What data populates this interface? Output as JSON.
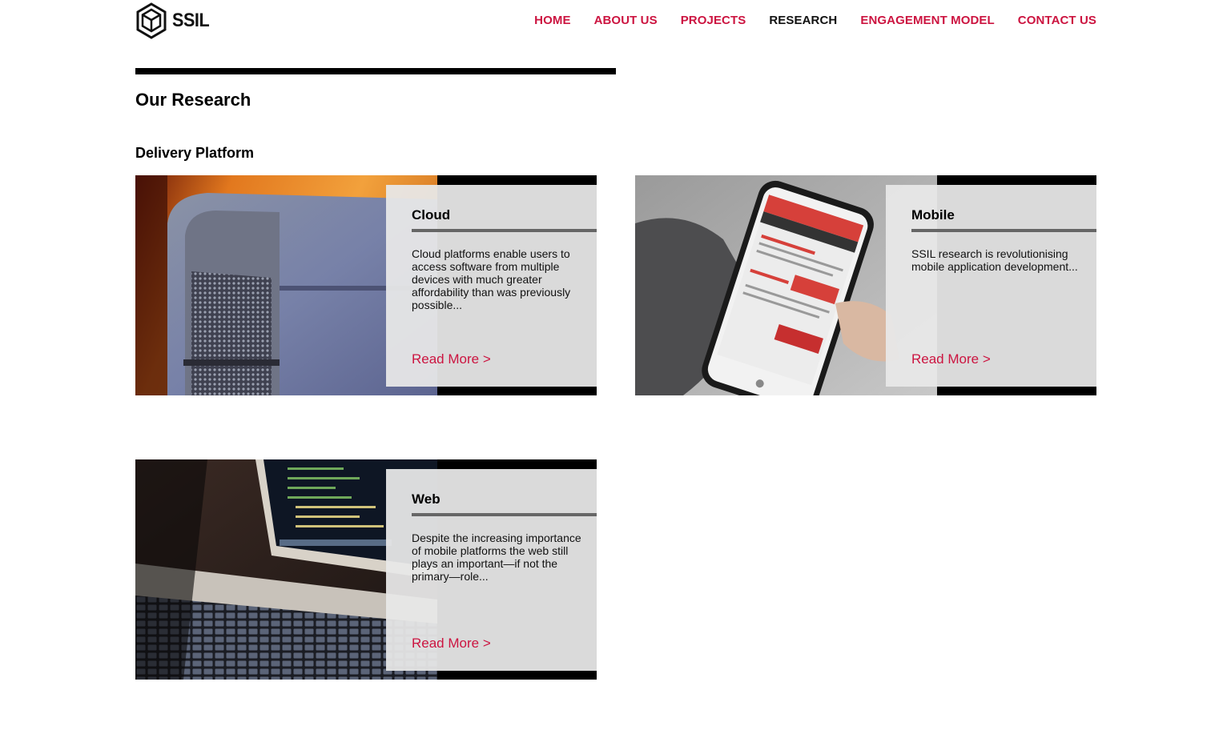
{
  "brand": {
    "name": "SSIL",
    "logo_icon": "hexagon-cube-logo"
  },
  "nav": {
    "items": [
      {
        "label": "HOME",
        "active": false
      },
      {
        "label": "ABOUT US",
        "active": false
      },
      {
        "label": "PROJECTS",
        "active": false
      },
      {
        "label": "RESEARCH",
        "active": true
      },
      {
        "label": "ENGAGEMENT MODEL",
        "active": false
      },
      {
        "label": "CONTACT US",
        "active": false
      }
    ]
  },
  "page": {
    "title": "Our Research",
    "section_title": "Delivery Platform"
  },
  "cards": [
    {
      "title": "Cloud",
      "text": "Cloud platforms enable users to access software from multiple devices with much greater affordability than was previously possible...",
      "link": "Read More >",
      "image": "mac-pro-computer-photo"
    },
    {
      "title": "Mobile",
      "text": "SSIL research is revolutionising mobile application development...",
      "link": "Read More >",
      "image": "smartphone-app-photo"
    },
    {
      "title": "Web",
      "text": "Despite the increasing importance of mobile platforms the web still plays an important—if not the primary—role...",
      "link": "Read More >",
      "image": "laptop-code-photo"
    }
  ],
  "colors": {
    "accent": "#cc1440",
    "nav_active": "#111111",
    "panel": "#e8e8e8",
    "rule": "#000000"
  }
}
